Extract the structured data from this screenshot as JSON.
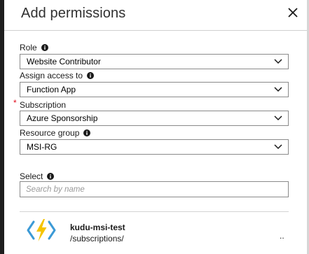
{
  "blade": {
    "title": "Add permissions"
  },
  "form": {
    "role": {
      "label": "Role",
      "value": "Website Contributor"
    },
    "assign_access": {
      "label": "Assign access to",
      "value": "Function App"
    },
    "subscription": {
      "label": "Subscription",
      "required_marker": "*",
      "value": "Azure Sponsorship"
    },
    "resource_group": {
      "label": "Resource group",
      "value": "MSI-RG"
    },
    "select": {
      "label": "Select",
      "placeholder": "Search by name"
    }
  },
  "results": [
    {
      "name": "kudu-msi-test",
      "path": "/subscriptions/",
      "more": "..",
      "icon": "azure-function-icon"
    }
  ],
  "colors": {
    "left_edge": "#1e1e1e",
    "required": "#e00b1c",
    "function_bolt": "#f5c400",
    "function_brackets": "#3c9ad6"
  }
}
